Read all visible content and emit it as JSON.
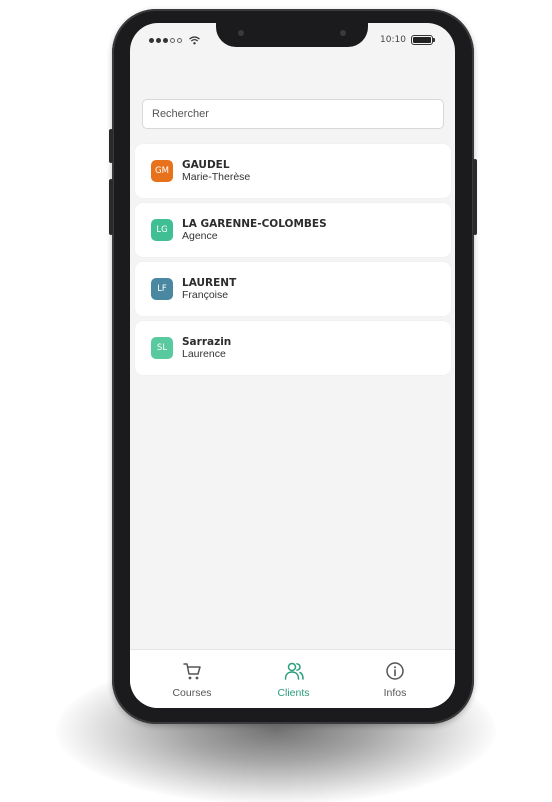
{
  "status_bar": {
    "time": "10:10",
    "icons": [
      "signal-dots-icon",
      "wifi-icon",
      "battery-icon"
    ]
  },
  "search": {
    "placeholder": "Rechercher",
    "value": ""
  },
  "clients": [
    {
      "initials": "GM",
      "name": "GAUDEL",
      "subtitle": "Marie-Therèse",
      "color": "#e8721c"
    },
    {
      "initials": "LG",
      "name": "LA GARENNE-COLOMBES",
      "subtitle": "Agence",
      "color": "#3fbf93"
    },
    {
      "initials": "LF",
      "name": "LAURENT",
      "subtitle": "Françoise",
      "color": "#4a87a0"
    },
    {
      "initials": "SL",
      "name": "Sarrazin",
      "subtitle": "Laurence",
      "color": "#59c9a0"
    }
  ],
  "tab_bar": {
    "tabs": [
      {
        "label": "Courses",
        "icon": "cart-icon",
        "active": false
      },
      {
        "label": "Clients",
        "icon": "users-icon",
        "active": true
      },
      {
        "label": "Infos",
        "icon": "info-icon",
        "active": false
      }
    ]
  },
  "colors": {
    "accent": "#2a9d7c",
    "screen_background": "#f4f4f4",
    "phone_frame": "#1b1b1d"
  }
}
